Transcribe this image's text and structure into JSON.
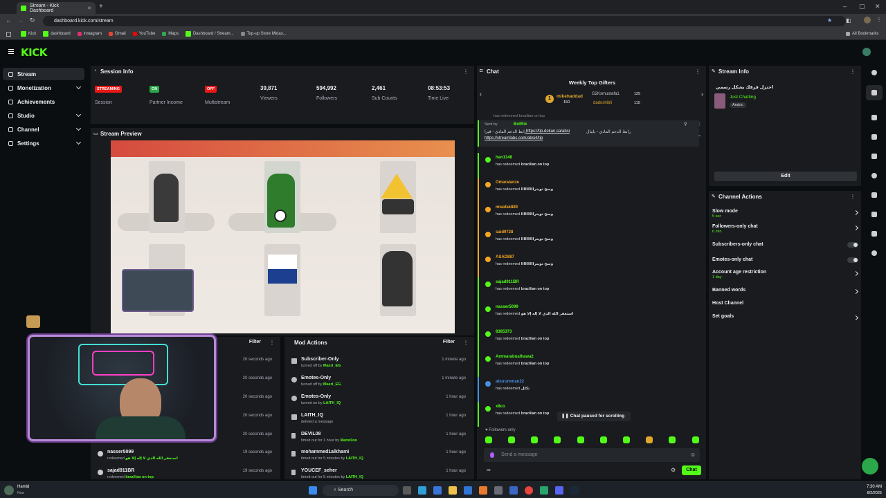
{
  "browser": {
    "tab_title": "Stream - Kick Dashboard",
    "url": "dashboard.kick.com/stream",
    "bookmarks": [
      "Kick",
      "dashboard",
      "instagram",
      "Gmail",
      "YouTube",
      "Maps",
      "Dashboard / Stream...",
      "Top-up Store Midas..."
    ],
    "all_bookmarks": "All Bookmarks"
  },
  "brand": {
    "logo": "KICK",
    "accent": "#53fc18"
  },
  "sidebar": {
    "items": [
      {
        "label": "Stream"
      },
      {
        "label": "Monetization"
      },
      {
        "label": "Achievements"
      },
      {
        "label": "Studio"
      },
      {
        "label": "Channel"
      },
      {
        "label": "Settings"
      }
    ]
  },
  "session": {
    "title": "Session Info",
    "stats": [
      {
        "badge": "STREAMING",
        "label": "Session"
      },
      {
        "badge": "ON",
        "label": "Partner Income"
      },
      {
        "badge": "OFF",
        "label": "Multistream"
      },
      {
        "value": "39,871",
        "label": "Viewers"
      },
      {
        "value": "594,992",
        "label": "Followers"
      },
      {
        "value": "2,461",
        "label": "Sub Counts"
      },
      {
        "value": "08:53:53",
        "label": "Time Live"
      }
    ]
  },
  "preview": {
    "title": "Stream Preview"
  },
  "activity": {
    "filter": "Filter",
    "rows": [
      {
        "time": "20 seconds ago"
      },
      {
        "time": "20 seconds ago"
      },
      {
        "time": "20 seconds ago"
      },
      {
        "time": "20 seconds ago"
      },
      {
        "time": "20 seconds ago"
      },
      {
        "name": "nasser5099",
        "sub": "استغفر الله الذي لا إله إلا هو",
        "prefix": "redeemed",
        "time": "19 seconds ago"
      },
      {
        "name": "sajad911BR",
        "prefix": "redeemed",
        "reward": "brazilian on top",
        "time": "19 seconds ago"
      }
    ]
  },
  "mod": {
    "title": "Mod Actions",
    "filter": "Filter",
    "rows": [
      {
        "name": "Subscriber-Only",
        "pre": "turned off by",
        "by": "Masri_EG",
        "time": "1 minute ago"
      },
      {
        "name": "Emotes-Only",
        "pre": "turned off by",
        "by": "Masri_EG",
        "time": "1 minute ago"
      },
      {
        "name": "Emotes-Only",
        "pre": "turned on by",
        "by": "LAITH_IQ",
        "time": "1 hour ago"
      },
      {
        "name": "LAITH_IQ",
        "pre": "deleted a message",
        "by": "",
        "time": "1 hour ago"
      },
      {
        "name": "DEVIL08",
        "pre": "timed out for 1 hour by",
        "by": "Mario0oo",
        "time": "1 hour ago"
      },
      {
        "name": "mohammed1alkhami",
        "pre": "timed out for 5 minutes by",
        "by": "LAITH_IQ",
        "time": "1 hour ago"
      },
      {
        "name": "YOUCEF_seher",
        "pre": "timed out for 5 minutes by",
        "by": "LAITH_IQ",
        "time": "1 hour ago"
      }
    ]
  },
  "chat": {
    "title": "Chat",
    "gifters_title": "Weekly Top Gifters",
    "gifters": [
      {
        "rank": "1",
        "name": "mikehaddad",
        "count": "150"
      },
      {
        "name": "G2Kxmustafa1",
        "count": "125"
      },
      {
        "name": "dadoshibli",
        "count": "115"
      }
    ],
    "partial_line": "has redeemed brazilian on top",
    "pinned": {
      "sent_by": "Sent by",
      "sender": "BotRix",
      "text": "رابط الدعم المادي - بايبال",
      "link1": "https://tip.dokan.sa/absi",
      "text2": "رابط الدعم المادي - فيزا",
      "link2": "https://streamlabs.com/absi4/tip"
    },
    "messages": [
      {
        "user": "han1348",
        "color": "#53fc18",
        "reward": "brazilian on top"
      },
      {
        "user": "Omaralanze",
        "color": "#f5a623",
        "reward": "وسخ تويتراااااااااا"
      },
      {
        "user": "mwafak889",
        "color": "#f5a623",
        "reward": "وسخ تويتراااااااااا"
      },
      {
        "user": "said9728",
        "color": "#f5a623",
        "reward": "وسخ تويتراااااااااا"
      },
      {
        "user": "ASAD887",
        "color": "#f5a623",
        "reward": "وسخ تويتراااااااااا"
      },
      {
        "user": "sajad911BR",
        "color": "#53fc18",
        "reward": "brazilian on top"
      },
      {
        "user": "nasser5099",
        "color": "#53fc18",
        "reward": "استغفر الله الذي لا إله إلا هو"
      },
      {
        "user": "8385373",
        "color": "#53fc18",
        "reward": "brazilian on top"
      },
      {
        "user": "Ammarabualhawa2",
        "color": "#53fc18",
        "reward": "brazilian on top"
      },
      {
        "user": "aburumman22",
        "color": "#4a90e2",
        "reward": "تكلل"
      },
      {
        "user": "x8co",
        "color": "#53fc18",
        "reward": "brazilian on top"
      }
    ],
    "redeemed_prefix": "has redeemed",
    "paused": "Chat paused for scrolling",
    "followers_only": "Followers only",
    "input_placeholder": "Send a message",
    "send_label": "Chat"
  },
  "stream_info": {
    "title": "Stream Info",
    "stream_title": "احتزل فرقك بشكل رسمي",
    "category": "Just Chatting",
    "language": "Arabic",
    "edit": "Edit"
  },
  "channel_actions": {
    "title": "Channel Actions",
    "items": [
      {
        "label": "Slow mode",
        "sub": "5 sec"
      },
      {
        "label": "Followers-only chat",
        "sub": "6 min"
      },
      {
        "label": "Subscribers-only chat"
      },
      {
        "label": "Emotes-only chat"
      },
      {
        "label": "Account age restriction",
        "sub": "1 day"
      },
      {
        "label": "Banned words"
      },
      {
        "label": "Host Channel"
      },
      {
        "label": "Set goals"
      }
    ]
  },
  "taskbar": {
    "user": "Hamid",
    "user_status": "Now",
    "search": "Search",
    "time": "7:30 AM",
    "date": "8/2/2025"
  }
}
